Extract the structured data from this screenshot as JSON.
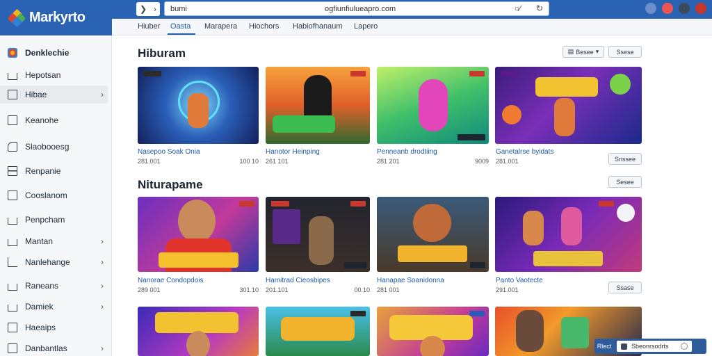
{
  "app": {
    "logo_text": "Markyrto"
  },
  "browser": {
    "tab_label": "bumi",
    "url": "ogfiunfiulueapro.com",
    "back_icon": "chevron-left-icon",
    "forward_icon": "chevron-right-icon",
    "reload_icon": "reload-icon"
  },
  "tabs": [
    {
      "label": "Hiuber"
    },
    {
      "label": "Oasta"
    },
    {
      "label": "Marapera"
    },
    {
      "label": "Hiochors"
    },
    {
      "label": "Habiofhanaum"
    },
    {
      "label": "Lapero"
    }
  ],
  "sidebar": {
    "items": [
      {
        "label": "Denklechie"
      },
      {
        "label": "Hepotsan"
      },
      {
        "label": "Hibae"
      },
      {
        "label": "Keanohe"
      },
      {
        "label": "Slaobooesg"
      },
      {
        "label": "Renpanie"
      },
      {
        "label": "Cooslanom"
      },
      {
        "label": "Penpcham"
      },
      {
        "label": "Mantan"
      },
      {
        "label": "Nanlehange"
      },
      {
        "label": "Raneans"
      },
      {
        "label": "Damiek"
      },
      {
        "label": "Haeaips"
      },
      {
        "label": "Danbantlas"
      }
    ]
  },
  "sections": [
    {
      "title": "Hiburam",
      "pills": [
        {
          "label": "Besee"
        },
        {
          "label": "Ssese"
        }
      ],
      "cards": [
        {
          "title": "Nasepoo Soak Onia",
          "meta": "281.001",
          "count": "100 10"
        },
        {
          "title": "Hanotor Heinping",
          "meta": "261 101",
          "count": ""
        },
        {
          "title": "Penneanb drodtiing",
          "meta": "281 201",
          "count": "9009"
        },
        {
          "title": "Ganetalrse byidats",
          "meta": "281.001",
          "count": ""
        }
      ],
      "side_pill": "Snssee"
    },
    {
      "title": "Niturapame",
      "pills": [
        {
          "label": "Sesee"
        }
      ],
      "cards": [
        {
          "title": "Nanorae Condopdois",
          "meta": "289 001",
          "count": "301.10"
        },
        {
          "title": "Hamitrad Cieosbipes",
          "meta": "201.101",
          "count": "00.10"
        },
        {
          "title": "Hanapae Soanidonna",
          "meta": "281 001",
          "count": ""
        },
        {
          "title": "Panto Vaotecte",
          "meta": "291.001",
          "count": ""
        }
      ],
      "side_pill": "Ssase"
    }
  ],
  "float_bar": {
    "left_label": "Rlect",
    "field_text": "Sbeonrsodrts"
  }
}
